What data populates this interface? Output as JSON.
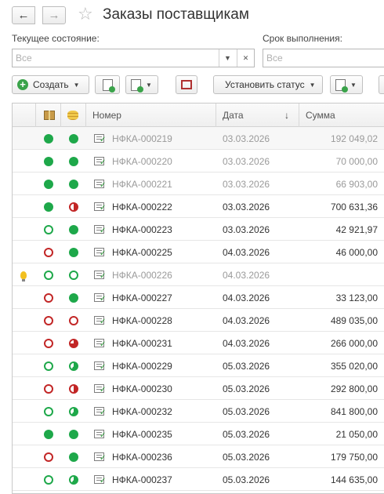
{
  "window": {
    "title": "Заказы поставщикам",
    "back_icon": "←",
    "forward_icon": "→",
    "favorite_icon": "☆"
  },
  "filters": {
    "state_label": "Текущее состояние:",
    "state_placeholder": "Все",
    "deadline_label": "Срок выполнения:",
    "deadline_placeholder": "Все"
  },
  "toolbar": {
    "create_label": "Создать",
    "set_status_label": "Установить статус"
  },
  "table": {
    "columns": [
      "Номер",
      "Дата",
      "Сумма"
    ],
    "rows": [
      {
        "number": "НФКА-000219",
        "date": "03.03.2026",
        "sum": "192 049,02",
        "s1": "fg",
        "s2": "fg",
        "dim": true
      },
      {
        "number": "НФКА-000220",
        "date": "03.03.2026",
        "sum": "70 000,00",
        "s1": "fg",
        "s2": "fg",
        "dim": true
      },
      {
        "number": "НФКА-000221",
        "date": "03.03.2026",
        "sum": "66 903,00",
        "s1": "fg",
        "s2": "fg",
        "dim": true
      },
      {
        "number": "НФКА-000222",
        "date": "03.03.2026",
        "sum": "700 631,36",
        "s1": "fg",
        "s2": "hr",
        "dim": false
      },
      {
        "number": "НФКА-000223",
        "date": "03.03.2026",
        "sum": "42 921,97",
        "s1": "og",
        "s2": "fg",
        "dim": false
      },
      {
        "number": "НФКА-000225",
        "date": "04.03.2026",
        "sum": "46 000,00",
        "s1": "or",
        "s2": "fg",
        "dim": false
      },
      {
        "number": "НФКА-000226",
        "date": "04.03.2026",
        "sum": "",
        "s1": "og",
        "s2": "og",
        "dim": true,
        "bulb": true
      },
      {
        "number": "НФКА-000227",
        "date": "04.03.2026",
        "sum": "33 123,00",
        "s1": "or",
        "s2": "fg",
        "dim": false
      },
      {
        "number": "НФКА-000228",
        "date": "04.03.2026",
        "sum": "489 035,00",
        "s1": "or",
        "s2": "or",
        "dim": false
      },
      {
        "number": "НФКА-000231",
        "date": "04.03.2026",
        "sum": "266 000,00",
        "s1": "or",
        "s2": "pr",
        "dim": false
      },
      {
        "number": "НФКА-000229",
        "date": "05.03.2026",
        "sum": "355 020,00",
        "s1": "og",
        "s2": "pg",
        "dim": false
      },
      {
        "number": "НФКА-000230",
        "date": "05.03.2026",
        "sum": "292 800,00",
        "s1": "or",
        "s2": "hr",
        "dim": false
      },
      {
        "number": "НФКА-000232",
        "date": "05.03.2026",
        "sum": "841 800,00",
        "s1": "og",
        "s2": "pg",
        "dim": false
      },
      {
        "number": "НФКА-000235",
        "date": "05.03.2026",
        "sum": "21 050,00",
        "s1": "fg",
        "s2": "fg",
        "dim": false
      },
      {
        "number": "НФКА-000236",
        "date": "05.03.2026",
        "sum": "179 750,00",
        "s1": "or",
        "s2": "fg",
        "dim": false
      },
      {
        "number": "НФКА-000237",
        "date": "05.03.2026",
        "sum": "144 635,00",
        "s1": "og",
        "s2": "pg",
        "dim": false
      }
    ]
  },
  "colors": {
    "green": "#1ea84a",
    "red": "#c22626",
    "dim_text": "#9a9a9a"
  }
}
